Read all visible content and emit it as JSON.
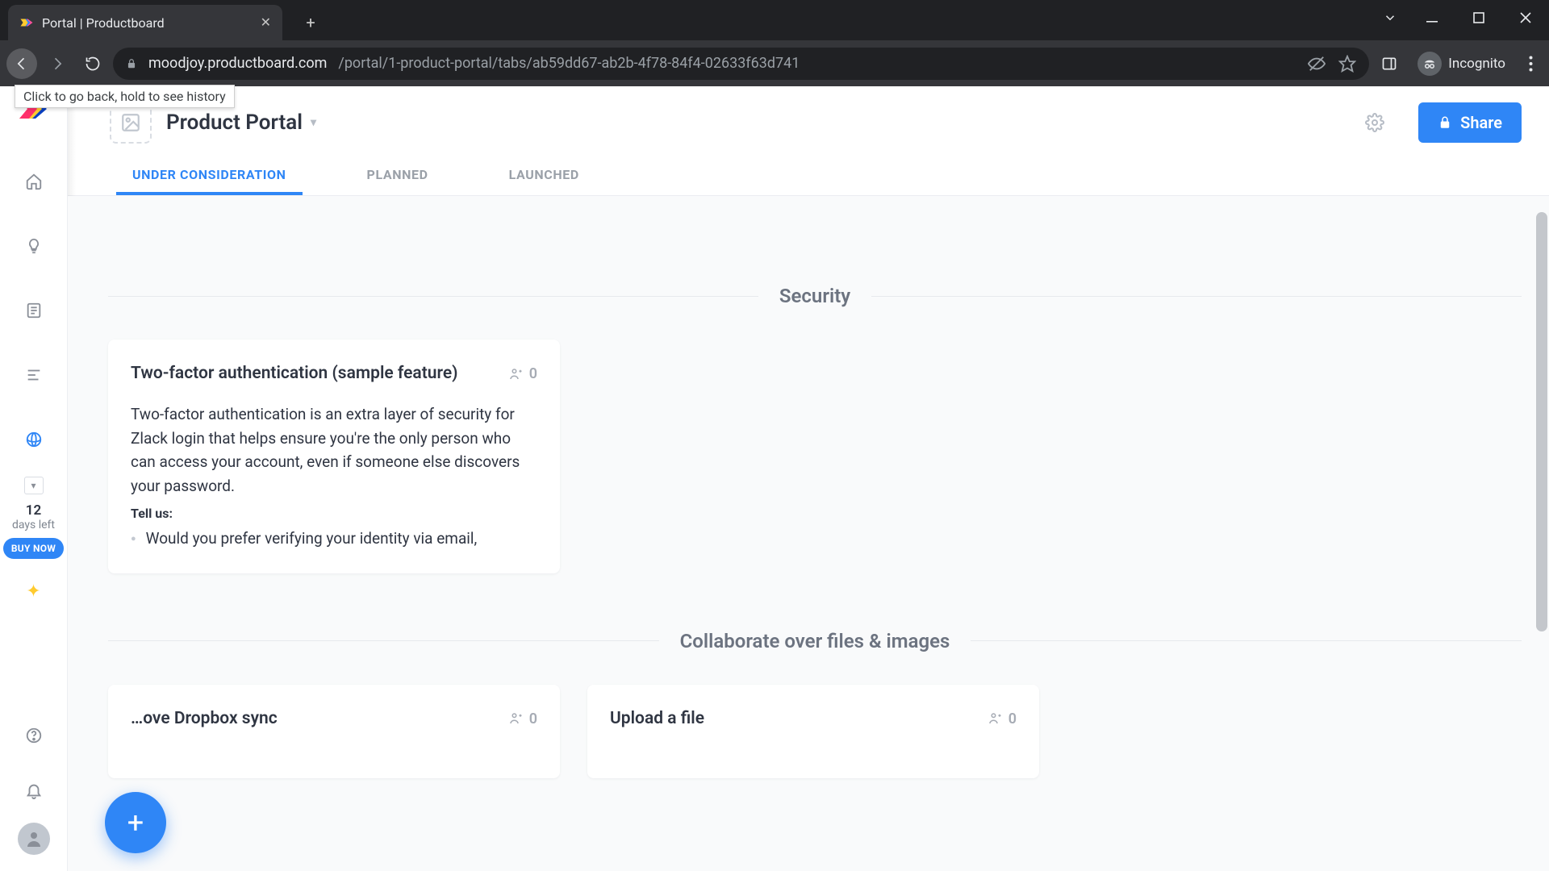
{
  "browser": {
    "tab_title": "Portal | Productboard",
    "url_host": "moodjoy.productboard.com",
    "url_path": "/portal/1-product-portal/tabs/ab59dd67-ab2b-4f78-84f4-02633f63d741",
    "incognito_label": "Incognito",
    "back_tooltip": "Click to go back, hold to see history"
  },
  "rail": {
    "trial_days_num": "12",
    "trial_days_label": "days left",
    "buy_now_label": "BUY NOW"
  },
  "header": {
    "title": "Product Portal",
    "share_label": "Share"
  },
  "tabs": [
    {
      "label": "UNDER CONSIDERATION",
      "active": true
    },
    {
      "label": "PLANNED",
      "active": false
    },
    {
      "label": "LAUNCHED",
      "active": false
    }
  ],
  "sections": [
    {
      "label": "Security",
      "cards": [
        {
          "title": "Two-factor authentication (sample feature)",
          "votes": "0",
          "body": "Two-factor authentication is an extra layer of security for Zlack login that helps ensure you're the only person who can access your account, even if someone else discovers your password.",
          "tell_us": "Tell us:",
          "bullets": [
            "Would you prefer verifying your identity via email,"
          ]
        }
      ]
    },
    {
      "label": "Collaborate over files & images",
      "cards": [
        {
          "title": "…ove Dropbox sync",
          "votes": "0"
        },
        {
          "title": "Upload a file",
          "votes": "0"
        }
      ]
    }
  ],
  "fab_label": "+"
}
